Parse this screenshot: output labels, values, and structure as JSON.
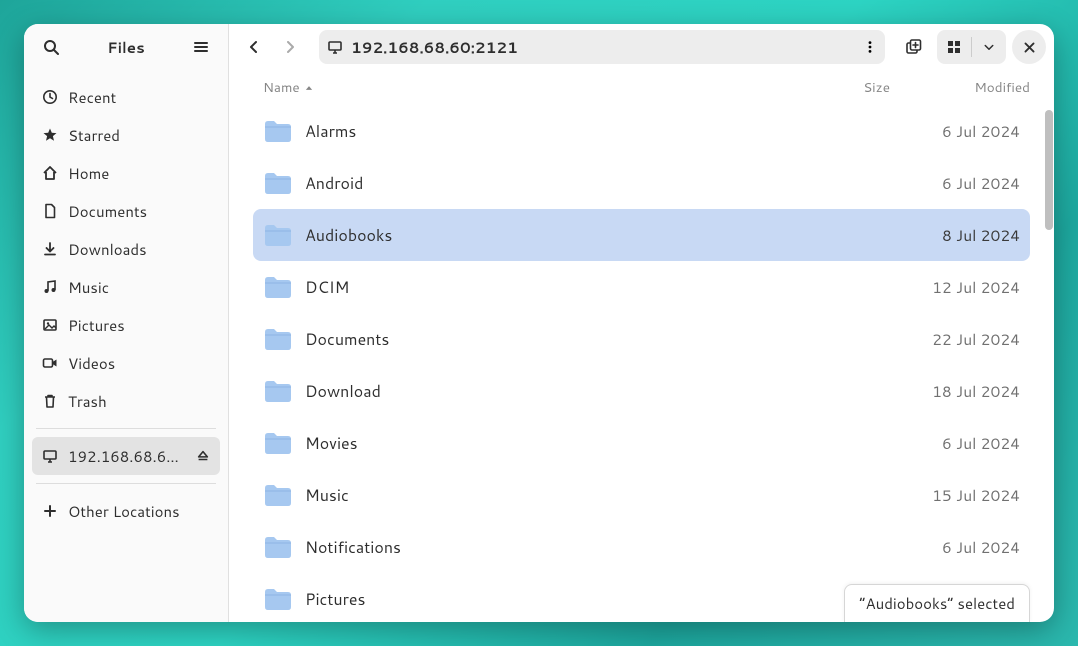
{
  "app": {
    "title": "Files"
  },
  "sidebar": {
    "items": [
      {
        "label": "Recent"
      },
      {
        "label": "Starred"
      },
      {
        "label": "Home"
      },
      {
        "label": "Documents"
      },
      {
        "label": "Downloads"
      },
      {
        "label": "Music"
      },
      {
        "label": "Pictures"
      },
      {
        "label": "Videos"
      },
      {
        "label": "Trash"
      }
    ],
    "mounts": [
      {
        "label": "192.168.68.6…"
      }
    ],
    "other_locations_label": "Other Locations"
  },
  "path": "192.168.68.60:2121",
  "columns": {
    "name": "Name",
    "size": "Size",
    "modified": "Modified"
  },
  "files": [
    {
      "name": "Alarms",
      "size": "",
      "modified": "6 Jul 2024",
      "selected": false
    },
    {
      "name": "Android",
      "size": "",
      "modified": "6 Jul 2024",
      "selected": false
    },
    {
      "name": "Audiobooks",
      "size": "",
      "modified": "8 Jul 2024",
      "selected": true
    },
    {
      "name": "DCIM",
      "size": "",
      "modified": "12 Jul 2024",
      "selected": false
    },
    {
      "name": "Documents",
      "size": "",
      "modified": "22 Jul 2024",
      "selected": false
    },
    {
      "name": "Download",
      "size": "",
      "modified": "18 Jul 2024",
      "selected": false
    },
    {
      "name": "Movies",
      "size": "",
      "modified": "6 Jul 2024",
      "selected": false
    },
    {
      "name": "Music",
      "size": "",
      "modified": "15 Jul 2024",
      "selected": false
    },
    {
      "name": "Notifications",
      "size": "",
      "modified": "6 Jul 2024",
      "selected": false
    },
    {
      "name": "Pictures",
      "size": "",
      "modified": "",
      "selected": false
    }
  ],
  "status_text": "“Audiobooks” selected"
}
